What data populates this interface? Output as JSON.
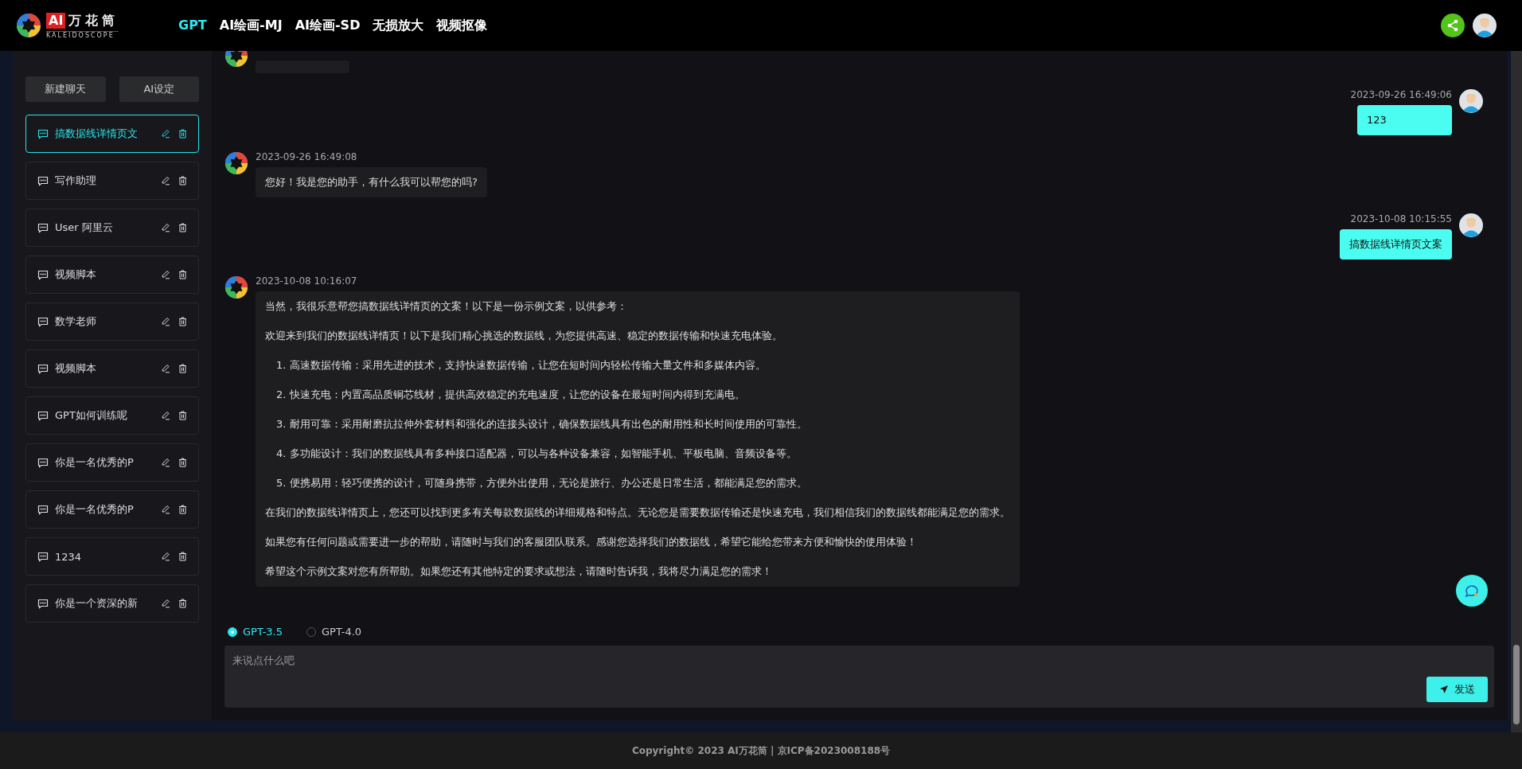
{
  "header": {
    "logo_badge": "AI",
    "logo_name": "万花筒",
    "logo_subtitle": "KALEIDOSCOPE",
    "nav": [
      {
        "label": "GPT",
        "selected": true
      },
      {
        "label": "AI绘画-MJ",
        "selected": false
      },
      {
        "label": "AI绘画-SD",
        "selected": false
      },
      {
        "label": "无损放大",
        "selected": false
      },
      {
        "label": "视频抠像",
        "selected": false
      }
    ]
  },
  "sidebar": {
    "buttons": [
      "新建聊天",
      "AI设定"
    ],
    "chats": [
      {
        "title": "搞数据线详情页文",
        "selected": true
      },
      {
        "title": "写作助理",
        "selected": false
      },
      {
        "title": "User 阿里云",
        "selected": false
      },
      {
        "title": "视频脚本",
        "selected": false
      },
      {
        "title": "数学老师",
        "selected": false
      },
      {
        "title": "视频脚本",
        "selected": false
      },
      {
        "title": "GPT如何训练呢",
        "selected": false
      },
      {
        "title": "你是一名优秀的P",
        "selected": false
      },
      {
        "title": "你是一名优秀的P",
        "selected": false
      },
      {
        "title": "1234",
        "selected": false
      },
      {
        "title": "你是一个资深的新",
        "selected": false
      }
    ]
  },
  "messages": [
    {
      "kind": "assistant",
      "clipped": true
    },
    {
      "kind": "user",
      "clipped": false,
      "time": "2023-09-26 16:49:06",
      "paragraphs": [
        {
          "kind": "para",
          "text": "123"
        }
      ]
    },
    {
      "kind": "assistant",
      "clipped": false,
      "time": "2023-09-26 16:49:08",
      "paragraphs": [
        {
          "kind": "para",
          "text": "您好！我是您的助手，有什么我可以帮您的吗?"
        }
      ]
    },
    {
      "kind": "user",
      "clipped": false,
      "time": "2023-10-08 10:15:55",
      "paragraphs": [
        {
          "kind": "para",
          "text": "搞数据线详情页文案"
        }
      ]
    },
    {
      "kind": "assistant",
      "clipped": false,
      "time": "2023-10-08 10:16:07",
      "paragraphs": [
        {
          "kind": "para",
          "text": "当然，我很乐意帮您搞数据线详情页的文案！以下是一份示例文案，以供参考："
        },
        {
          "kind": "para",
          "text": "欢迎来到我们的数据线详情页！以下是我们精心挑选的数据线，为您提供高速、稳定的数据传输和快速充电体验。"
        },
        {
          "kind": "item",
          "text": "1. 高速数据传输：采用先进的技术，支持快速数据传输，让您在短时间内轻松传输大量文件和多媒体内容。"
        },
        {
          "kind": "item",
          "text": "2. 快速充电：内置高品质铜芯线材，提供高效稳定的充电速度，让您的设备在最短时间内得到充满电。"
        },
        {
          "kind": "item",
          "text": "3. 耐用可靠：采用耐磨抗拉伸外套材料和强化的连接头设计，确保数据线具有出色的耐用性和长时间使用的可靠性。"
        },
        {
          "kind": "item",
          "text": "4. 多功能设计：我们的数据线具有多种接口适配器，可以与各种设备兼容，如智能手机、平板电脑、音频设备等。"
        },
        {
          "kind": "item",
          "text": "5. 便携易用：轻巧便携的设计，可随身携带，方便外出使用，无论是旅行、办公还是日常生活，都能满足您的需求。"
        },
        {
          "kind": "para",
          "text": "在我们的数据线详情页上，您还可以找到更多有关每款数据线的详细规格和特点。无论您是需要数据传输还是快速充电，我们相信我们的数据线都能满足您的需求。"
        },
        {
          "kind": "para",
          "text": "如果您有任何问题或需要进一步的帮助，请随时与我们的客服团队联系。感谢您选择我们的数据线，希望它能给您带来方便和愉快的使用体验！"
        },
        {
          "kind": "para",
          "text": "希望这个示例文案对您有所帮助。如果您还有其他特定的要求或想法，请随时告诉我，我将尽力满足您的需求！"
        }
      ]
    }
  ],
  "model_options": [
    {
      "label": "GPT-3.5",
      "selected": true
    },
    {
      "label": "GPT-4.0",
      "selected": false
    }
  ],
  "composer": {
    "placeholder": "来说点什么吧",
    "send_label": "发送"
  },
  "footer": {
    "text": "Copyright© 2023 AI万花筒 | 京ICP备2023008188号"
  }
}
